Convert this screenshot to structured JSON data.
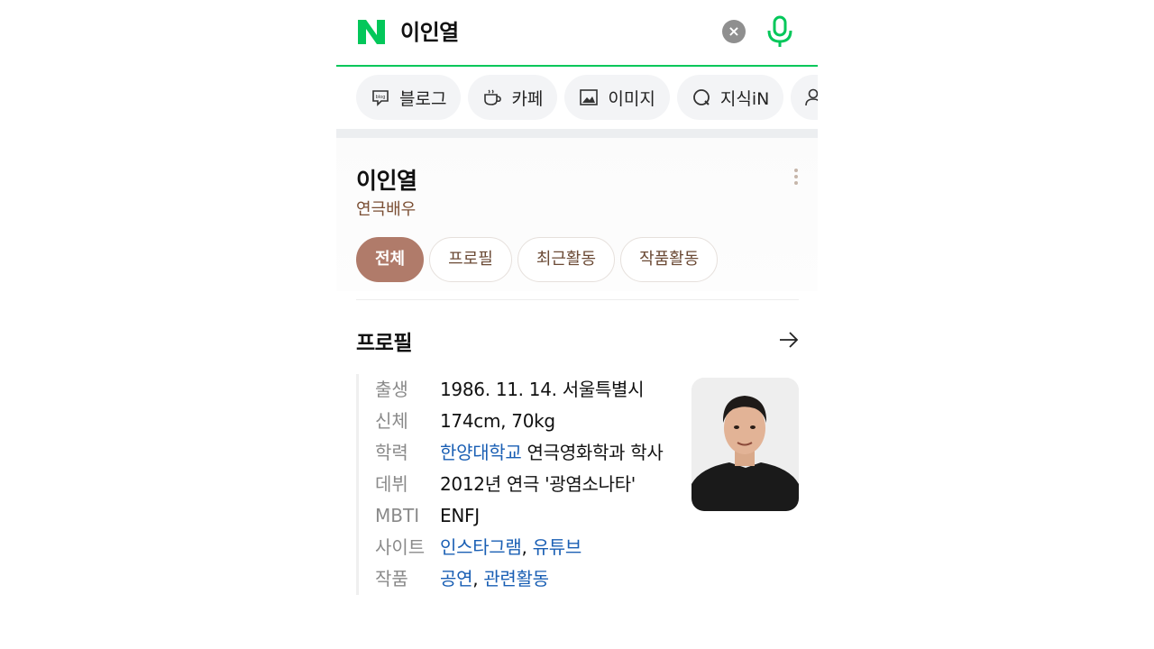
{
  "search": {
    "query": "이인열",
    "clear_symbol": "×"
  },
  "chips": [
    {
      "label": "블로그",
      "icon": "blog-icon"
    },
    {
      "label": "카페",
      "icon": "cafe-cup-icon"
    },
    {
      "label": "이미지",
      "icon": "image-icon"
    },
    {
      "label": "지식iN",
      "icon": "knowledge-q-icon"
    },
    {
      "label": "",
      "icon": "person-icon"
    }
  ],
  "person": {
    "name": "이인열",
    "description": "연극배우"
  },
  "tabs": [
    {
      "label": "전체",
      "active": true
    },
    {
      "label": "프로필",
      "active": false
    },
    {
      "label": "최근활동",
      "active": false
    },
    {
      "label": "작품활동",
      "active": false
    }
  ],
  "profile": {
    "title": "프로필",
    "rows": [
      {
        "key": "출생",
        "value": "1986. 11. 14. 서울특별시"
      },
      {
        "key": "신체",
        "value": "174cm, 70kg"
      },
      {
        "key": "학력",
        "link": "한양대학교",
        "rest": " 연극영화학과 학사"
      },
      {
        "key": "데뷔",
        "value": "2012년 연극 '광염소나타'"
      },
      {
        "key": "MBTI",
        "value": "ENFJ"
      },
      {
        "key": "사이트",
        "links": [
          "인스타그램",
          "유튜브"
        ],
        "sep": ", "
      },
      {
        "key": "작품",
        "links": [
          "공연",
          "관련활동"
        ],
        "sep": ", "
      }
    ]
  },
  "colors": {
    "brand_green": "#03c75a",
    "active_tab": "#b07b6a",
    "link_blue": "#1a5fb4",
    "description_brown": "#7a4e33"
  }
}
